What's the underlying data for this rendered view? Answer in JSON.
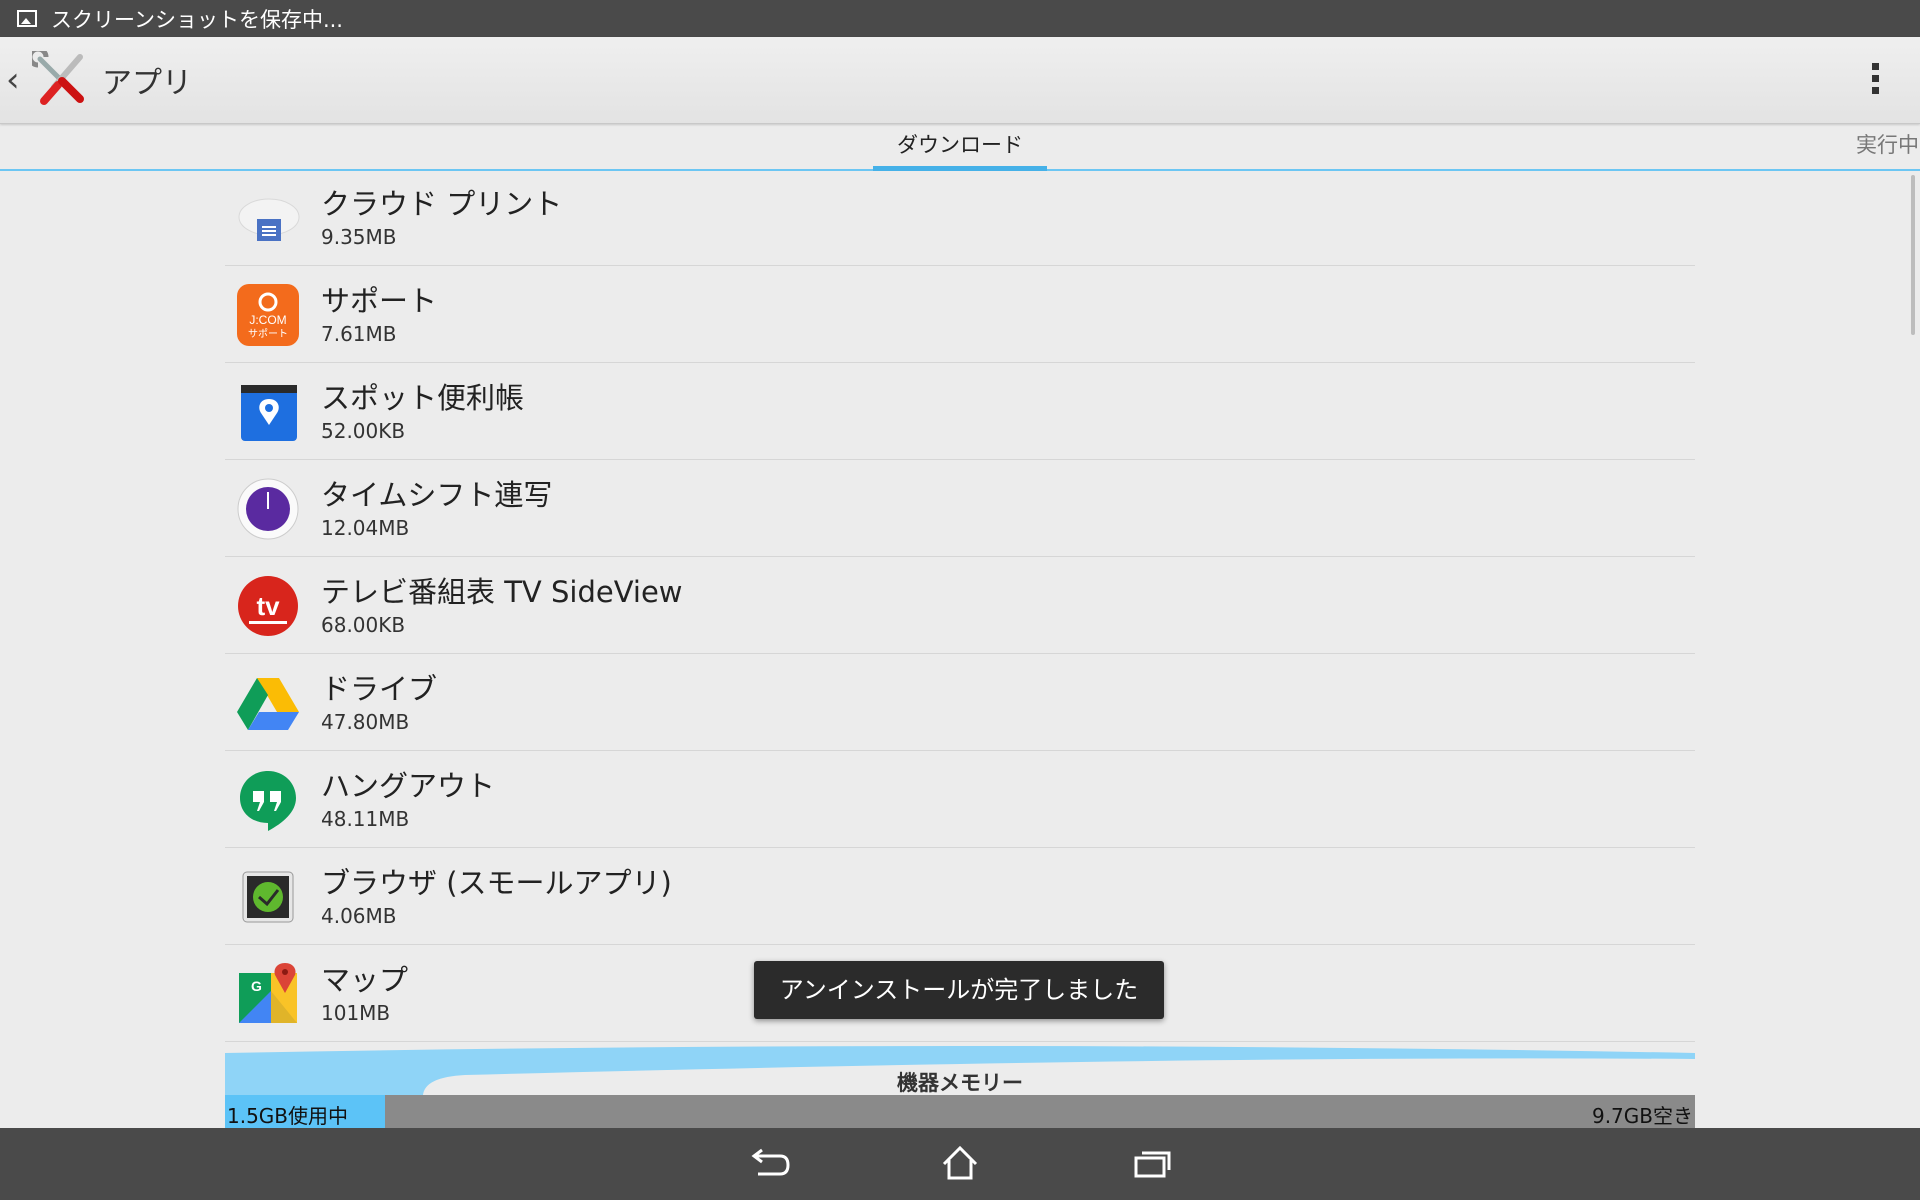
{
  "status_bar": {
    "notification_text": "スクリーンショットを保存中..."
  },
  "action_bar": {
    "title": "アプリ",
    "back_icon": "back-chevron-icon",
    "menu_icon": "overflow-menu-icon"
  },
  "tabs": {
    "active": "ダウンロード",
    "next_partial": "実行中"
  },
  "apps": [
    {
      "name": "クラウド プリント",
      "size": "9.35MB",
      "icon": "cloud-print-icon"
    },
    {
      "name": "サポート",
      "size": "7.61MB",
      "icon": "jcom-support-icon",
      "icon_text_1": "J:COM",
      "icon_text_2": "サポート"
    },
    {
      "name": "スポット便利帳",
      "size": "52.00KB",
      "icon": "spot-notebook-icon"
    },
    {
      "name": "タイムシフト連写",
      "size": "12.04MB",
      "icon": "timeshift-icon"
    },
    {
      "name": "テレビ番組表 TV SideView",
      "size": "68.00KB",
      "icon": "tv-sideview-icon",
      "icon_text": "tv"
    },
    {
      "name": "ドライブ",
      "size": "47.80MB",
      "icon": "drive-icon"
    },
    {
      "name": "ハングアウト",
      "size": "48.11MB",
      "icon": "hangouts-icon"
    },
    {
      "name": "ブラウザ (スモールアプリ)",
      "size": "4.06MB",
      "icon": "browser-small-app-icon"
    },
    {
      "name": "マップ",
      "size": "101MB",
      "icon": "maps-icon",
      "icon_text": "G"
    }
  ],
  "storage": {
    "label": "機器メモリー",
    "used": "1.5GB使用中",
    "free": "9.7GB空き",
    "used_fraction": 0.109
  },
  "toast": "アンインストールが完了しました",
  "colors": {
    "accent": "#45b1e8",
    "storage_used": "#5cc3f7",
    "bar_bg": "#4a4a4a"
  }
}
